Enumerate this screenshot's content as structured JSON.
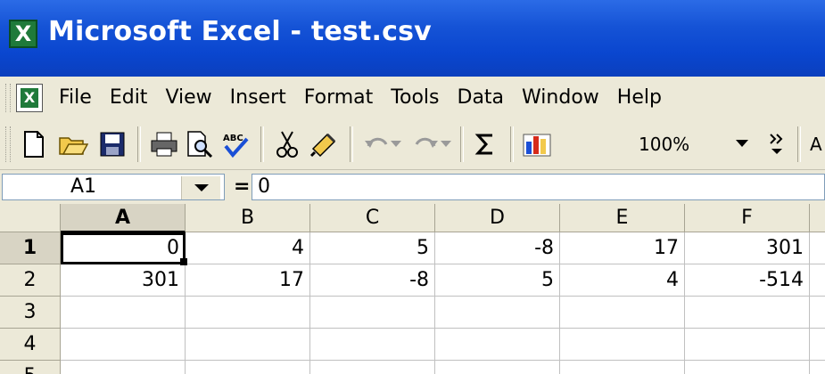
{
  "window": {
    "title": "Microsoft Excel - test.csv",
    "app_icon": "excel-icon"
  },
  "menu": [
    "File",
    "Edit",
    "View",
    "Insert",
    "Format",
    "Tools",
    "Data",
    "Window",
    "Help"
  ],
  "toolbar": {
    "buttons": [
      "new-icon",
      "open-icon",
      "save-icon",
      "print-icon",
      "print-preview-icon",
      "spelling-icon",
      "cut-icon",
      "format-painter-icon",
      "undo-icon",
      "redo-icon",
      "autosum-icon",
      "chart-wizard-icon"
    ],
    "zoom": "100%",
    "cutoff_label": "A"
  },
  "formula_bar": {
    "name_box": "A1",
    "equals": "=",
    "value": "0"
  },
  "grid": {
    "columns": [
      "A",
      "B",
      "C",
      "D",
      "E",
      "F"
    ],
    "rows": [
      "1",
      "2",
      "3",
      "4",
      "5"
    ],
    "cells": [
      [
        "0",
        "4",
        "5",
        "-8",
        "17",
        "301"
      ],
      [
        "301",
        "17",
        "-8",
        "5",
        "4",
        "-514"
      ],
      [
        "",
        "",
        "",
        "",
        "",
        ""
      ],
      [
        "",
        "",
        "",
        "",
        "",
        ""
      ],
      [
        "",
        "",
        "",
        "",
        "",
        ""
      ]
    ],
    "active_cell": "A1"
  },
  "colors": {
    "titlebar": "#0a46cf",
    "chrome": "#ece9d8",
    "header_selected": "#d8d4c4",
    "gridline": "#c0c0c0"
  }
}
